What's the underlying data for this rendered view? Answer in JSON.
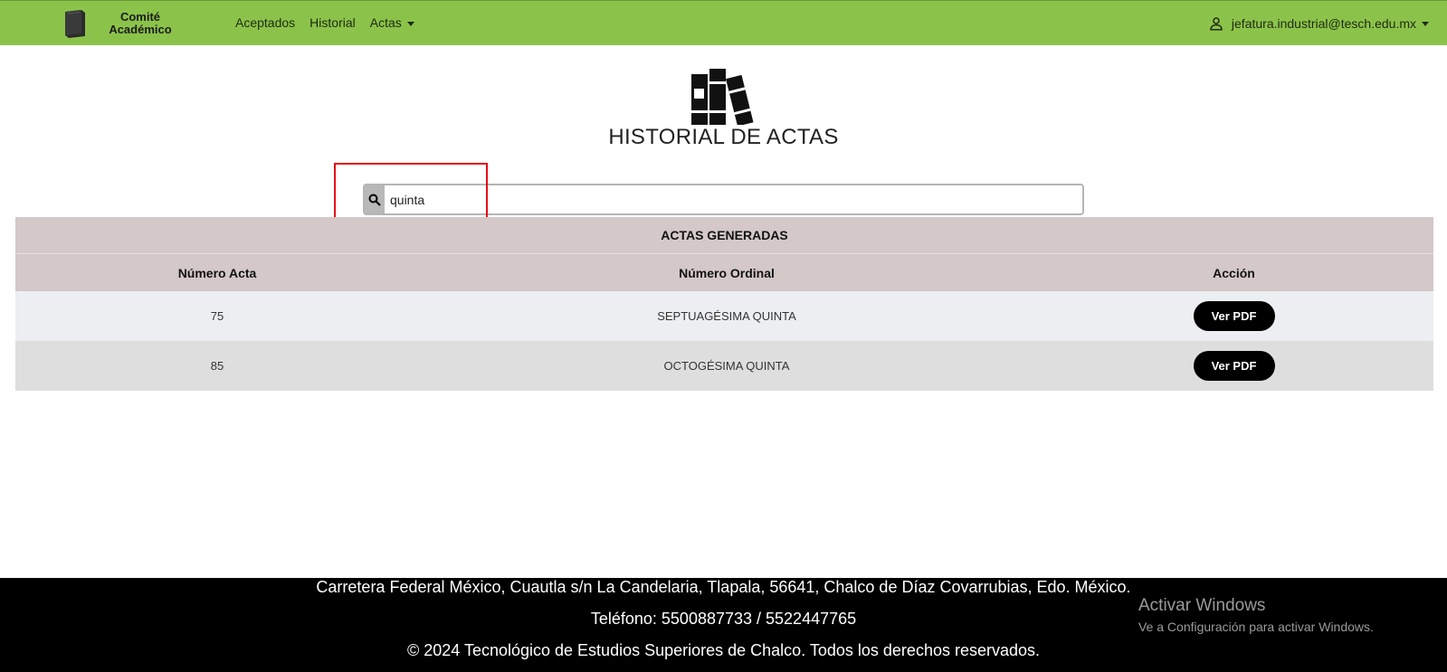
{
  "navbar": {
    "brand": "Comité Académico",
    "links": [
      "Aceptados",
      "Historial",
      "Actas"
    ],
    "user_email": "jefatura.industrial@tesch.edu.mx"
  },
  "page": {
    "title": "HISTORIAL DE ACTAS"
  },
  "search": {
    "value": "quinta"
  },
  "table": {
    "caption": "ACTAS GENERADAS",
    "headers": [
      "Número Acta",
      "Número Ordinal",
      "Acción"
    ],
    "rows": [
      {
        "numero": "75",
        "ordinal": "SEPTUAGÉSIMA QUINTA",
        "action": "Ver PDF"
      },
      {
        "numero": "85",
        "ordinal": "OCTOGÉSIMA QUINTA",
        "action": "Ver PDF"
      }
    ]
  },
  "footer": {
    "address": "Carretera Federal México, Cuautla s/n La Candelaria, Tlapala, 56641, Chalco de Díaz Covarrubias, Edo. México.",
    "phone": "Teléfono: 5500887733 / 5522447765",
    "copyright": "© 2024 Tecnológico de Estudios Superiores de Chalco. Todos los derechos reservados."
  },
  "watermark": {
    "title": "Activar Windows",
    "subtitle": "Ve a Configuración para activar Windows."
  },
  "colors": {
    "navbar": "#8bc34a",
    "table_header": "#d4c8c8",
    "highlight": "#e30613",
    "footer": "#000000"
  }
}
